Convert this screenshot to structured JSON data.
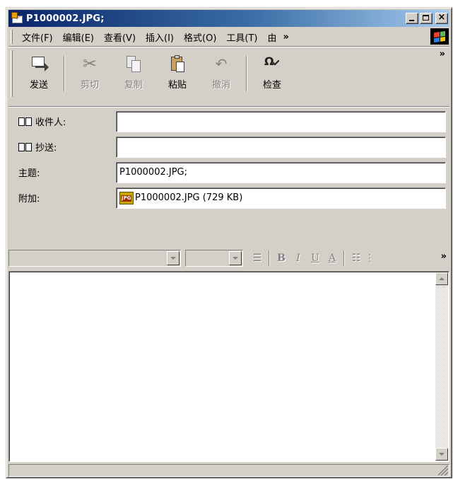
{
  "window": {
    "title": "P1000002.JPG;",
    "caption_buttons": {
      "minimize": "_",
      "maximize": "□",
      "close": "×"
    }
  },
  "menubar": {
    "items": [
      "文件(F)",
      "编辑(E)",
      "查看(V)",
      "插入(I)",
      "格式(O)",
      "工具(T)",
      "由"
    ],
    "more": "»"
  },
  "toolbar": {
    "buttons": [
      {
        "label": "发送",
        "icon": "send-icon",
        "enabled": true
      },
      {
        "label": "剪切",
        "icon": "cut-icon",
        "enabled": false
      },
      {
        "label": "复制",
        "icon": "copy-icon",
        "enabled": false
      },
      {
        "label": "粘贴",
        "icon": "paste-icon",
        "enabled": true
      },
      {
        "label": "撤消",
        "icon": "undo-icon",
        "enabled": false
      },
      {
        "label": "检查",
        "icon": "check-names-icon",
        "enabled": true
      }
    ],
    "more": "»"
  },
  "fields": {
    "to": {
      "label": "收件人:",
      "value": ""
    },
    "cc": {
      "label": "抄送:",
      "value": ""
    },
    "subject": {
      "label": "主题:",
      "value": "P1000002.JPG;"
    },
    "attach": {
      "label": "附加:",
      "value": "P1000002.JPG (729 KB)",
      "icon_text": "JPG"
    }
  },
  "format_toolbar": {
    "font_name": "",
    "font_size": "",
    "buttons": [
      "B",
      "I",
      "U",
      "A"
    ],
    "more": "»"
  },
  "editor": {
    "body": ""
  },
  "colors": {
    "face": "#d4d0c8",
    "title_start": "#0a246a",
    "title_end": "#a6caf0"
  }
}
